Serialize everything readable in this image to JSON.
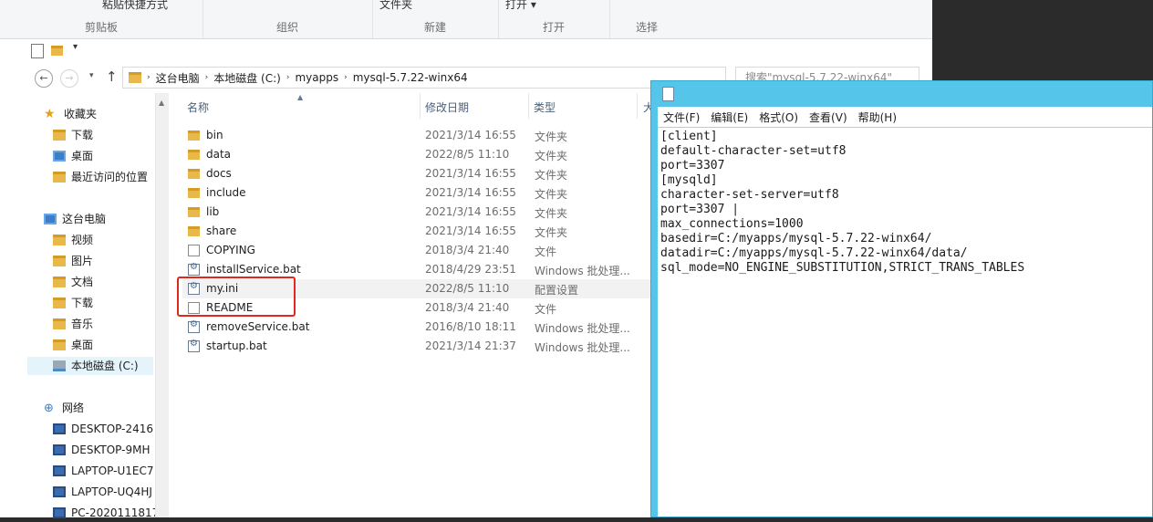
{
  "ribbon": {
    "paste_shortcut": "粘贴快捷方式",
    "folder_label": "文件夹",
    "open_label": "打开",
    "groups": [
      "剪贴板",
      "组织",
      "新建",
      "打开",
      "选择"
    ]
  },
  "nav": {
    "breadcrumb": [
      "这台电脑",
      "本地磁盘 (C:)",
      "myapps",
      "mysql-5.7.22-winx64"
    ],
    "search_placeholder": "搜索\"mysql-5.7.22-winx64\""
  },
  "sidebar": {
    "favorites": "收藏夹",
    "fav_items": [
      "下载",
      "桌面",
      "最近访问的位置"
    ],
    "thispc": "这台电脑",
    "pc_items": [
      "视频",
      "图片",
      "文档",
      "下载",
      "音乐",
      "桌面",
      "本地磁盘 (C:)"
    ],
    "network": "网络",
    "net_items": [
      "DESKTOP-2416",
      "DESKTOP-9MH",
      "LAPTOP-U1EC7",
      "LAPTOP-UQ4HJ",
      "PC-2020111817"
    ]
  },
  "columns": {
    "name": "名称",
    "date": "修改日期",
    "type": "类型",
    "size": "大"
  },
  "files": [
    {
      "name": "bin",
      "date": "2021/3/14 16:55",
      "type": "文件夹",
      "kind": "folder"
    },
    {
      "name": "data",
      "date": "2022/8/5 11:10",
      "type": "文件夹",
      "kind": "folder"
    },
    {
      "name": "docs",
      "date": "2021/3/14 16:55",
      "type": "文件夹",
      "kind": "folder"
    },
    {
      "name": "include",
      "date": "2021/3/14 16:55",
      "type": "文件夹",
      "kind": "folder"
    },
    {
      "name": "lib",
      "date": "2021/3/14 16:55",
      "type": "文件夹",
      "kind": "folder"
    },
    {
      "name": "share",
      "date": "2021/3/14 16:55",
      "type": "文件夹",
      "kind": "folder"
    },
    {
      "name": "COPYING",
      "date": "2018/3/4 21:40",
      "type": "文件",
      "kind": "file"
    },
    {
      "name": "installService.bat",
      "date": "2018/4/29 23:51",
      "type": "Windows 批处理...",
      "kind": "bat"
    },
    {
      "name": "my.ini",
      "date": "2022/8/5 11:10",
      "type": "配置设置",
      "kind": "ini"
    },
    {
      "name": "README",
      "date": "2018/3/4 21:40",
      "type": "文件",
      "kind": "file"
    },
    {
      "name": "removeService.bat",
      "date": "2016/8/10 18:11",
      "type": "Windows 批处理...",
      "kind": "bat"
    },
    {
      "name": "startup.bat",
      "date": "2021/3/14 21:37",
      "type": "Windows 批处理...",
      "kind": "bat"
    }
  ],
  "notepad": {
    "menu": [
      "文件(F)",
      "编辑(E)",
      "格式(O)",
      "查看(V)",
      "帮助(H)"
    ],
    "content": "[client]\ndefault-character-set=utf8\nport=3307\n[mysqld]\ncharacter-set-server=utf8\nport=3307 |\nmax_connections=1000\nbasedir=C:/myapps/mysql-5.7.22-winx64/\ndatadir=C:/myapps/mysql-5.7.22-winx64/data/\nsql_mode=NO_ENGINE_SUBSTITUTION,STRICT_TRANS_TABLES"
  }
}
